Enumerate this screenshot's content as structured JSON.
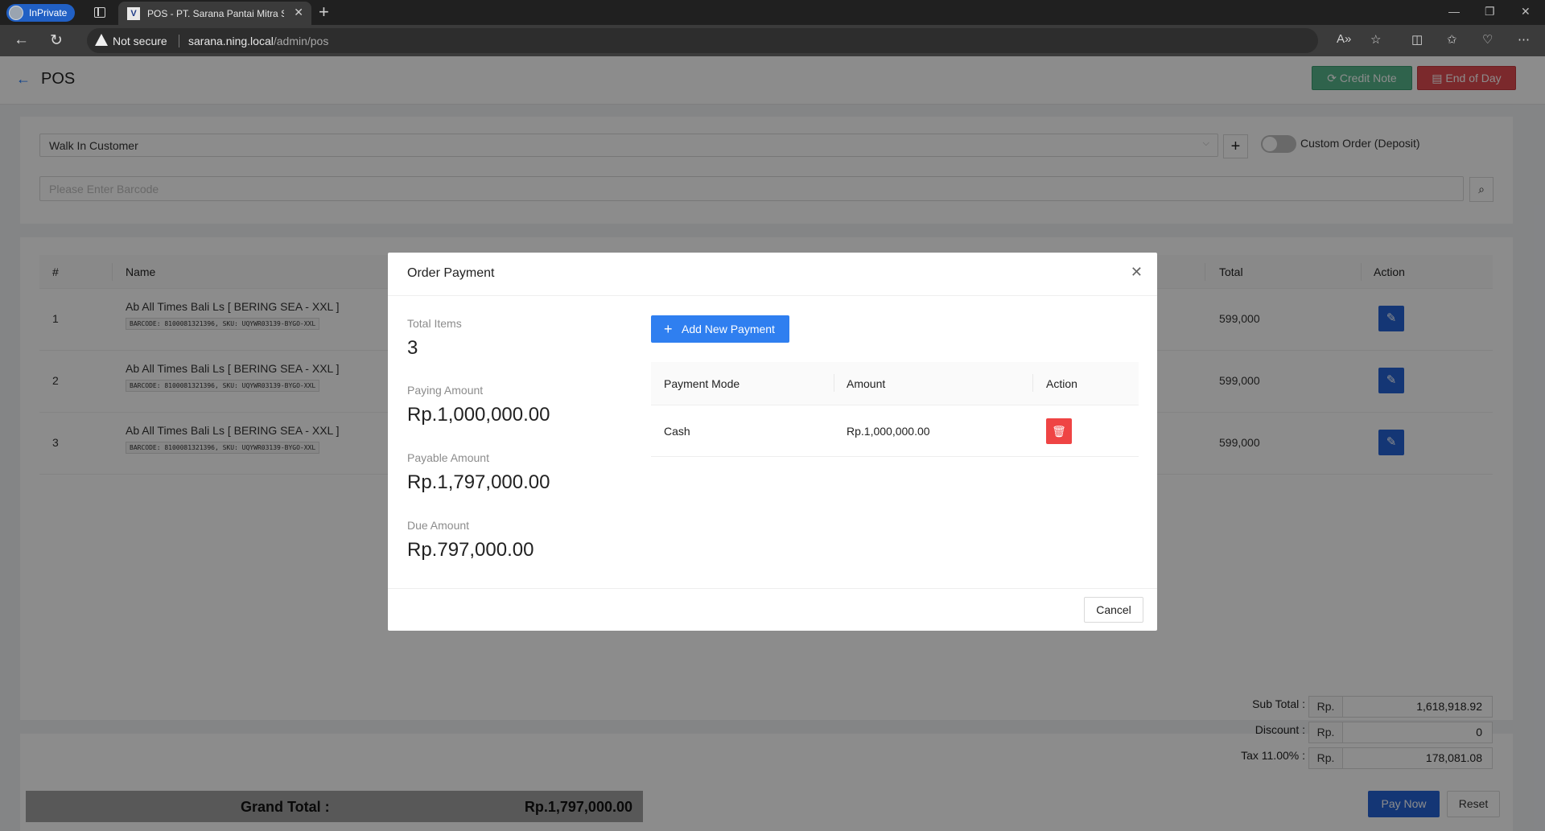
{
  "browser": {
    "inprivate_label": "InPrivate",
    "tab_title": "POS - PT. Sarana Pantai Mitra Se...",
    "not_secure": "Not secure",
    "url_host": "sarana.ning.local",
    "url_path": "/admin/pos"
  },
  "header": {
    "title": "POS",
    "credit_note": "Credit Note",
    "end_of_day": "End of Day"
  },
  "filters": {
    "customer": "Walk In Customer",
    "custom_order_label": "Custom Order (Deposit)",
    "custom_order_on": false,
    "barcode_placeholder": "Please Enter Barcode"
  },
  "cart": {
    "columns": {
      "num": "#",
      "name": "Name",
      "total": "Total",
      "action": "Action"
    },
    "rows": [
      {
        "num": "1",
        "name": "Ab All Times Bali Ls [ BERING SEA - XXL ]",
        "meta": "BARCODE: 8100081321396, SKU: UQYWR03139-BYGO-XXL",
        "total": "599,000"
      },
      {
        "num": "2",
        "name": "Ab All Times Bali Ls [ BERING SEA - XXL ]",
        "meta": "BARCODE: 8100081321396, SKU: UQYWR03139-BYGO-XXL",
        "total": "599,000"
      },
      {
        "num": "3",
        "name": "Ab All Times Bali Ls [ BERING SEA - XXL ]",
        "meta": "BARCODE: 8100081321396, SKU: UQYWR03139-BYGO-XXL",
        "total": "599,000"
      }
    ]
  },
  "summary": {
    "currency": "Rp.",
    "sub_total_label": "Sub Total :",
    "sub_total": "1,618,918.92",
    "discount_label": "Discount :",
    "discount": "0",
    "tax_label": "Tax 11.00% :",
    "tax": "178,081.08",
    "grand_total_label": "Grand Total :",
    "grand_total": "Rp.1,797,000.00",
    "pay_now": "Pay Now",
    "reset": "Reset"
  },
  "modal": {
    "title": "Order Payment",
    "total_items_label": "Total Items",
    "total_items": "3",
    "paying_amount_label": "Paying Amount",
    "paying_amount": "Rp.1,000,000.00",
    "payable_amount_label": "Payable Amount",
    "payable_amount": "Rp.1,797,000.00",
    "due_amount_label": "Due Amount",
    "due_amount": "Rp.797,000.00",
    "add_payment": "Add New Payment",
    "columns": {
      "mode": "Payment Mode",
      "amount": "Amount",
      "action": "Action"
    },
    "payments": [
      {
        "mode": "Cash",
        "amount": "Rp.1,000,000.00"
      }
    ],
    "cancel": "Cancel"
  },
  "colors": {
    "primary": "#2563d6",
    "credit_note": "#56b58a",
    "end_of_day": "#e04b50",
    "delete": "#ef4444"
  }
}
